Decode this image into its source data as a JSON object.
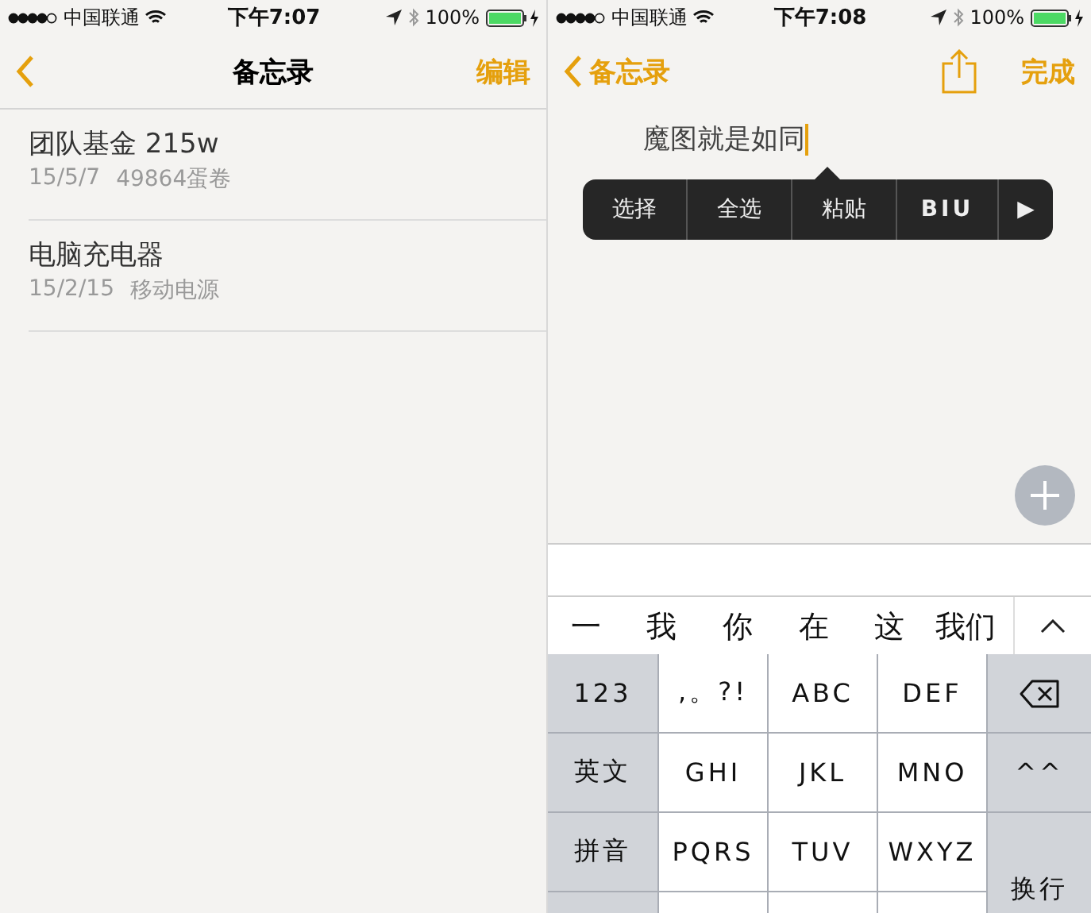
{
  "list_screen": {
    "status_bar": {
      "carrier": "中国联通",
      "time": "下午7:07",
      "battery": "100%"
    },
    "nav": {
      "title": "备忘录",
      "edit": "编辑"
    },
    "notes": [
      {
        "title": "团队基金 215w",
        "date": "15/5/7",
        "preview": "49864蛋卷"
      },
      {
        "title": "电脑充电器",
        "date": "15/2/15",
        "preview": "移动电源"
      }
    ]
  },
  "edit_screen": {
    "status_bar": {
      "carrier": "中国联通",
      "time": "下午7:08",
      "battery": "100%"
    },
    "nav": {
      "back": "备忘录",
      "done": "完成"
    },
    "note_text": "魔图就是如同",
    "menu": [
      {
        "label": "选择",
        "kind": "text"
      },
      {
        "label": "全选",
        "kind": "text"
      },
      {
        "label": "粘贴",
        "kind": "text"
      },
      {
        "label": "BIU",
        "kind": "format"
      },
      {
        "label": "▶",
        "kind": "more"
      }
    ],
    "candidates": [
      "一",
      "我",
      "你",
      "在",
      "这",
      "我们"
    ],
    "keys": [
      {
        "label": "123",
        "kind": "function"
      },
      {
        "label": ",。?!",
        "kind": "letter"
      },
      {
        "label": "ABC",
        "kind": "letter"
      },
      {
        "label": "DEF",
        "kind": "letter"
      },
      {
        "kind": "delete"
      },
      {
        "label": "英文",
        "kind": "function"
      },
      {
        "label": "GHI",
        "kind": "letter"
      },
      {
        "label": "JKL",
        "kind": "letter"
      },
      {
        "label": "MNO",
        "kind": "letter"
      },
      {
        "label": "^^",
        "kind": "emoji"
      },
      {
        "label": "拼音",
        "kind": "function"
      },
      {
        "label": "PQRS",
        "kind": "letter"
      },
      {
        "label": "TUV",
        "kind": "letter"
      },
      {
        "label": "WXYZ",
        "kind": "letter"
      },
      {
        "label": "换行",
        "kind": "return"
      }
    ]
  }
}
